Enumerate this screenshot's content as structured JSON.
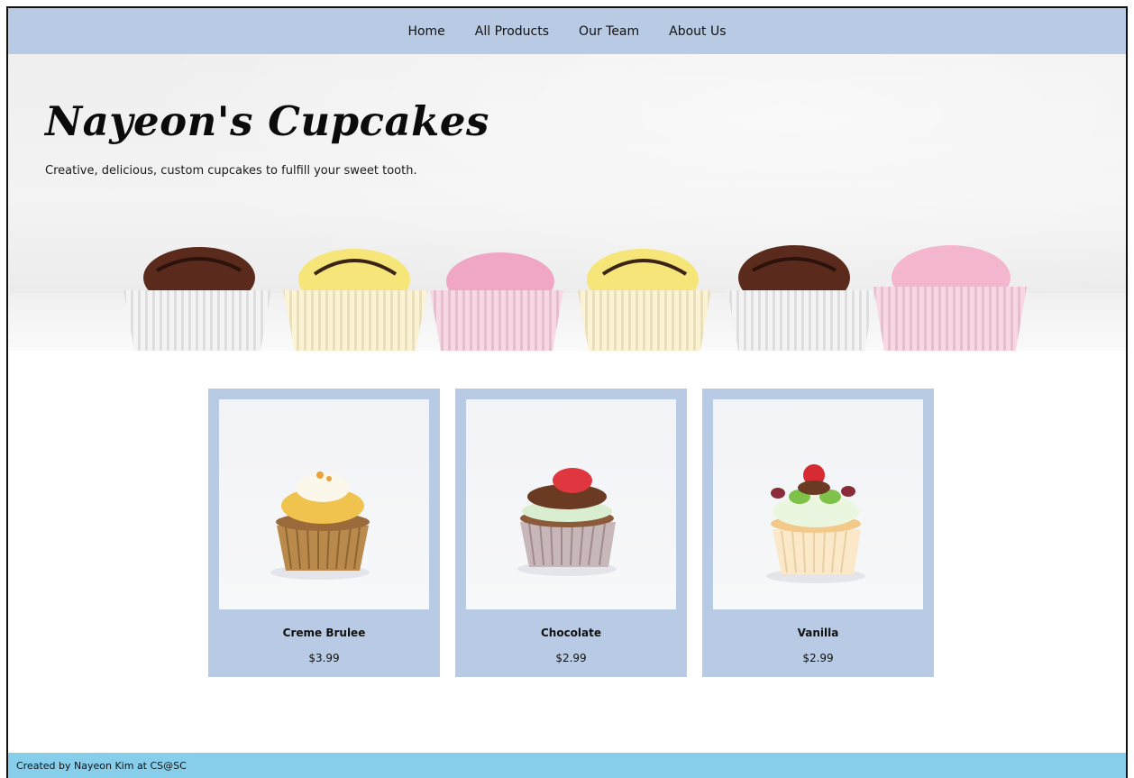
{
  "nav": {
    "items": [
      "Home",
      "All Products",
      "Our Team",
      "About Us"
    ]
  },
  "hero": {
    "title": "Nayeon's Cupcakes",
    "subtitle": "Creative, delicious, custom cupcakes to fulfill your sweet tooth."
  },
  "products": [
    {
      "name": "Creme Brulee",
      "price": "$3.99"
    },
    {
      "name": "Chocolate",
      "price": "$2.99"
    },
    {
      "name": "Vanilla",
      "price": "$2.99"
    }
  ],
  "footer": {
    "text": "Created by Nayeon Kim at CS@SC"
  },
  "colors": {
    "nav_bg": "#b9cbe4",
    "card_bg": "#b9cbe4",
    "footer_bg": "#87ceeb"
  }
}
